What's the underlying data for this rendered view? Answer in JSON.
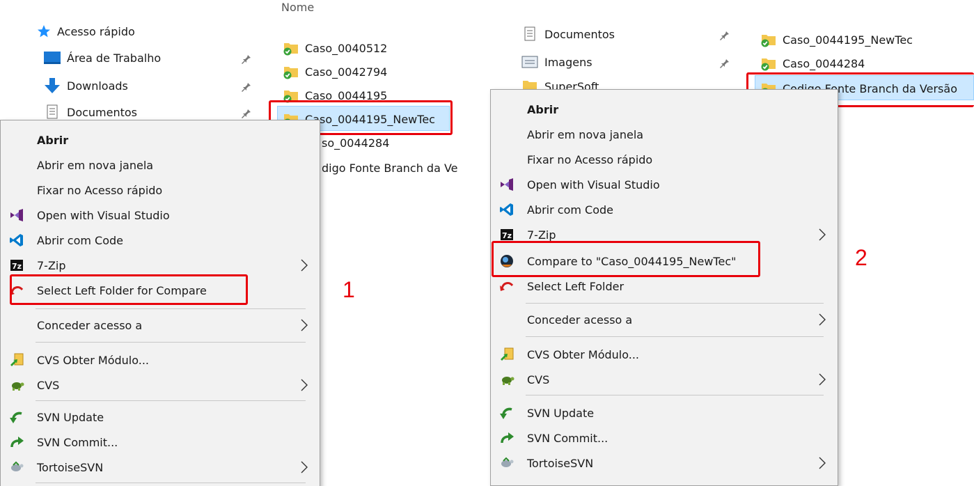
{
  "left_panel": {
    "column_header": "Nome",
    "nav": [
      {
        "label": "Acesso rápido",
        "icon": "star-icon"
      },
      {
        "label": "Área de Trabalho",
        "icon": "desktop-icon"
      },
      {
        "label": "Downloads",
        "icon": "download-arrow-icon"
      },
      {
        "label": "Documentos",
        "icon": "documents-icon"
      }
    ],
    "files": [
      "Caso_0040512",
      "Caso_0042794",
      "Caso_0044195",
      "Caso_0044195_NewTec",
      "so_0044284",
      "digo Fonte Branch da Ve"
    ],
    "menu": {
      "items": [
        {
          "label": "Abrir"
        },
        {
          "label": "Abrir em nova janela"
        },
        {
          "label": "Fixar no Acesso rápido"
        },
        {
          "label": "Open with Visual Studio"
        },
        {
          "label": "Abrir com Code"
        },
        {
          "label": "7-Zip"
        },
        {
          "label": "Select Left Folder for Compare"
        },
        {
          "label": "Conceder acesso a"
        },
        {
          "label": "CVS Obter Módulo..."
        },
        {
          "label": "CVS"
        },
        {
          "label": "SVN Update"
        },
        {
          "label": "SVN Commit..."
        },
        {
          "label": "TortoiseSVN"
        }
      ]
    },
    "step_label": "1"
  },
  "right_panel": {
    "nav": [
      {
        "label": "Documentos",
        "icon": "documents-icon"
      },
      {
        "label": "Imagens",
        "icon": "images-icon"
      },
      {
        "label": "SuperSoft",
        "icon": "folder-icon"
      }
    ],
    "files": [
      "Caso_0044195_NewTec",
      "Caso_0044284",
      "Codigo Fonte Branch da Versão"
    ],
    "menu": {
      "items": [
        {
          "label": "Abrir"
        },
        {
          "label": "Abrir em nova janela"
        },
        {
          "label": "Fixar no Acesso rápido"
        },
        {
          "label": "Open with Visual Studio"
        },
        {
          "label": "Abrir com Code"
        },
        {
          "label": "7-Zip"
        },
        {
          "label": "Compare to \"Caso_0044195_NewTec\""
        },
        {
          "label": "Select Left Folder"
        },
        {
          "label": "Conceder acesso a"
        },
        {
          "label": "CVS Obter Módulo..."
        },
        {
          "label": "CVS"
        },
        {
          "label": "SVN Update"
        },
        {
          "label": "SVN Commit..."
        },
        {
          "label": "TortoiseSVN"
        }
      ]
    },
    "step_label": "2"
  },
  "colors": {
    "highlight": "#e8000b",
    "selection": "#cce8ff",
    "menu_bg": "#f2f2f2"
  }
}
